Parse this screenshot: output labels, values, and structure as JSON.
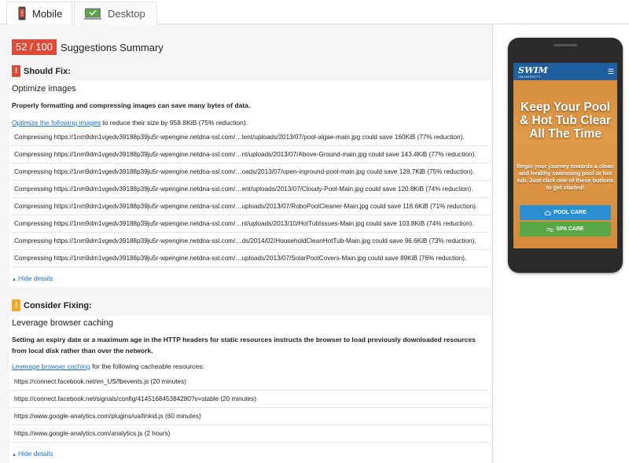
{
  "tabs": [
    {
      "label": "Mobile",
      "active": true,
      "icon": "mobile-icon"
    },
    {
      "label": "Desktop",
      "active": false,
      "icon": "desktop-icon"
    }
  ],
  "score": "52 / 100",
  "summary_title": "Suggestions Summary",
  "should_fix": {
    "heading": "Should Fix:",
    "badge": "!",
    "rule_title": "Optimize images",
    "description": "Properly formatting and compressing images can save many bytes of data.",
    "link_text": "Optimize the following images",
    "link_suffix": " to reduce their size by 958.8KiB (75% reduction).",
    "items": [
      "Compressing https://1nm9dm1vgedv39188p39ju5r-wpengine.netdna-ssl.com/…tent/uploads/2013/07/pool-algae-main.jpg could save 160KiB (77% reduction).",
      "Compressing https://1nm9dm1vgedv39188p39ju5r-wpengine.netdna-ssl.com/…nt/uploads/2013/07/Above-Ground-main.jpg could save 143.4KiB (77% reduction).",
      "Compressing https://1nm9dm1vgedv39188p39ju5r-wpengine.netdna-ssl.com/…oads/2013/07/open-inground-pool-main.jpg could save 128.7KiB (75% reduction).",
      "Compressing https://1nm9dm1vgedv39188p39ju5r-wpengine.netdna-ssl.com/…ent/uploads/2013/07/Cloudy-Pool-Main.jpg could save 120.8KiB (74% reduction).",
      "Compressing https://1nm9dm1vgedv39188p39ju5r-wpengine.netdna-ssl.com/…uploads/2013/07/RoboPoolCleaner-Main.jpg could save 116.6KiB (71% reduction).",
      "Compressing https://1nm9dm1vgedv39188p39ju5r-wpengine.netdna-ssl.com/…nt/uploads/2013/10/HotTubIssues-Main.jpg could save 103.8KiB (74% reduction).",
      "Compressing https://1nm9dm1vgedv39188p39ju5r-wpengine.netdna-ssl.com/…ds/2014/02/HouseholdCleanHotTub-Main.jpg could save 96.6KiB (73% reduction).",
      "Compressing https://1nm9dm1vgedv39188p39ju5r-wpengine.netdna-ssl.com/…uploads/2013/07/SolarPoolCovers-Main.jpg could save 89KiB (76% reduction)."
    ],
    "hide_label": "Hide details"
  },
  "consider_fixing": {
    "heading": "Consider Fixing:",
    "badge": "!",
    "rule_title": "Leverage browser caching",
    "description": "Setting an expiry date or a maximum age in the HTTP headers for static resources instructs the browser to load previously downloaded resources from local disk rather than over the network.",
    "link_text": "Leverage browser caching",
    "link_suffix": " for the following cacheable resources:",
    "items": [
      "https://connect.facebook.net/en_US/fbevents.js (20 minutes)",
      "https://connect.facebook.net/signals/config/414516845384280?v=stable (20 minutes)",
      "https://www.google-analytics.com/plugins/ua/linkid.js (60 minutes)",
      "https://www.google-analytics.com/analytics.js (2 hours)"
    ],
    "hide_label": "Hide details"
  },
  "preview": {
    "logo": "SWIM",
    "logo_sub": "UNIVERSITY",
    "menu_icon": "☰",
    "headline": "Keep Your Pool & Hot Tub Clear All The Time",
    "subline": "Begin your journey towards a clean and healthy swimming pool or hot tub. Just click one of these buttons to get started!",
    "pool_button": "POOL CARE",
    "spa_button": "SPA CARE"
  },
  "colors": {
    "score_bg": "#dd4b39",
    "should_fix_badge": "#dd4b39",
    "consider_badge": "#f5a623",
    "link": "#1a73c8",
    "site_header": "#1f5f9e"
  }
}
